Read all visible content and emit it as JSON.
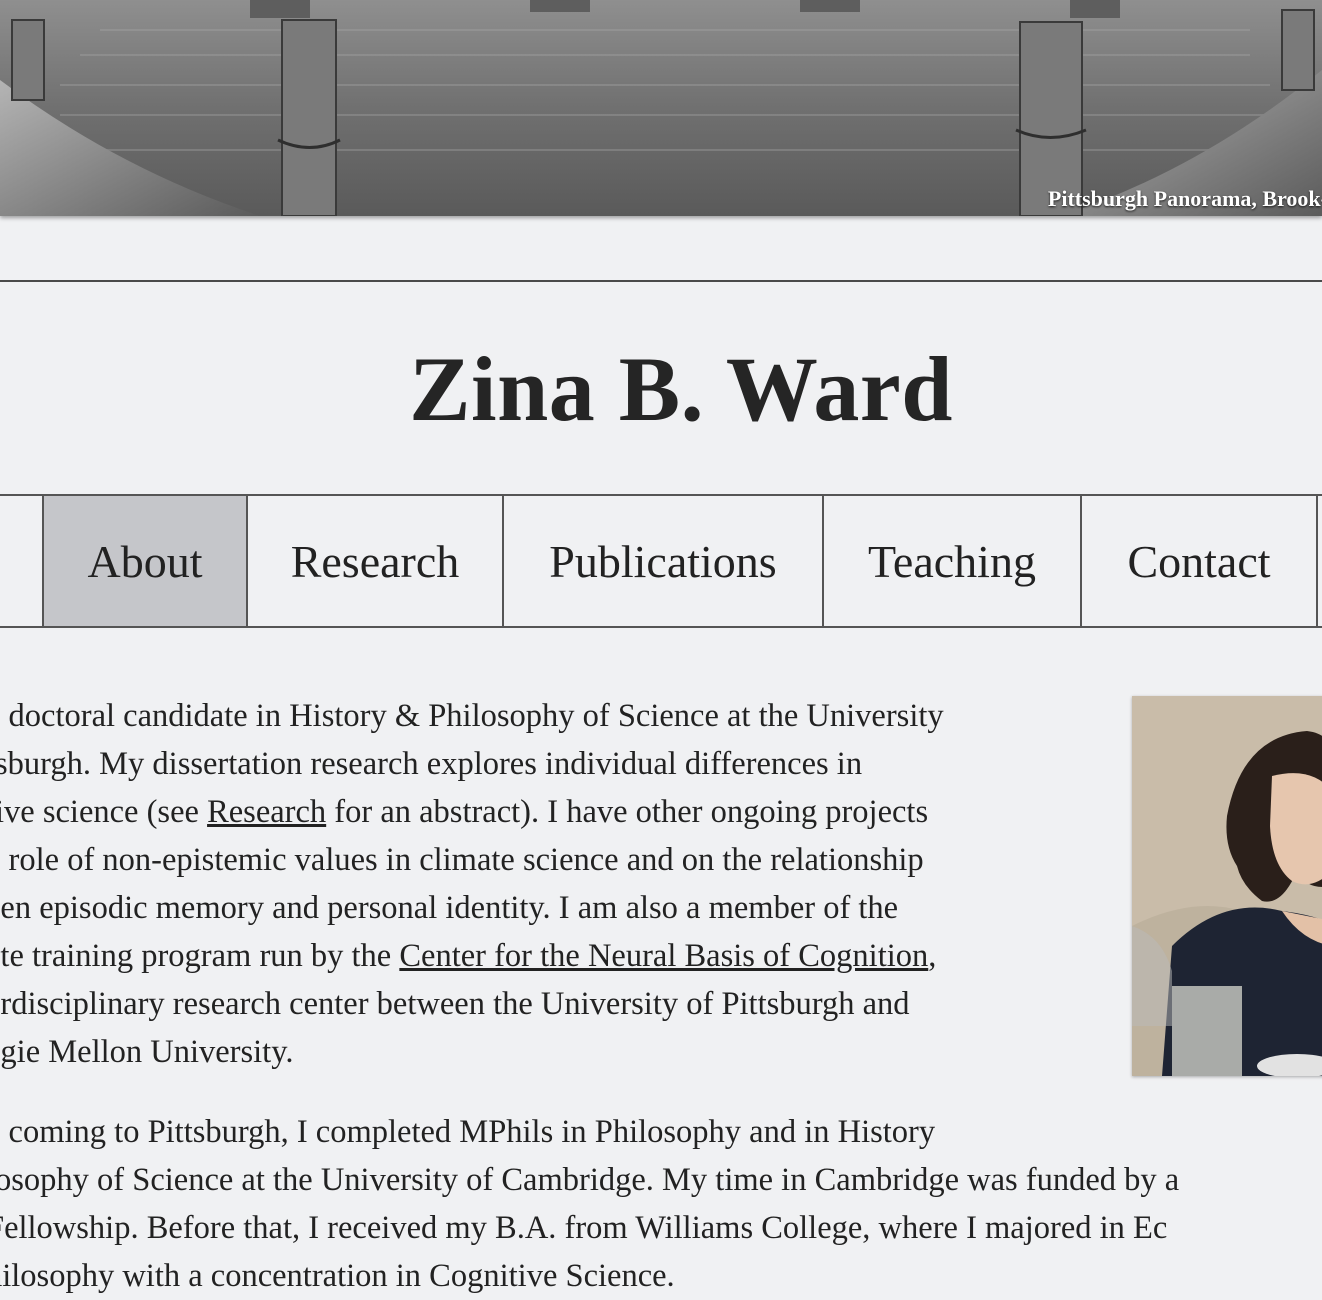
{
  "banner": {
    "caption": "Pittsburgh Panorama, Brook-"
  },
  "site": {
    "title": "Zina B. Ward"
  },
  "nav": {
    "items": [
      {
        "label": "About",
        "active": true
      },
      {
        "label": "Research",
        "active": false
      },
      {
        "label": "Publications",
        "active": false
      },
      {
        "label": "Teaching",
        "active": false
      },
      {
        "label": "Contact",
        "active": false
      }
    ]
  },
  "about": {
    "para1_lines": [
      "a doctoral candidate in History & Philosophy of Science at the University",
      "tsburgh. My dissertation research explores individual differences in",
      "tive science (see ",
      "Research",
      " for an abstract). I have other ongoing projects",
      "e role of non-epistemic values in climate science and on the relationship",
      "een episodic memory and personal identity. I am also a member of the",
      "ate training program run by the ",
      "Center for the Neural Basis of Cognition",
      ",",
      "erdisciplinary research center between the University of Pittsburgh and",
      "egie Mellon University."
    ],
    "para2_lines": [
      "e coming to Pittsburgh, I completed MPhils in Philosophy and in History",
      "losophy of Science at the University of Cambridge. My time in Cambridge was funded by a",
      " Fellowship. Before that, I received my B.A. from Williams College, where I majored in Ec",
      "hilosophy with a concentration in Cognitive Science."
    ]
  },
  "icons": {
    "portrait": "portrait-photo"
  }
}
